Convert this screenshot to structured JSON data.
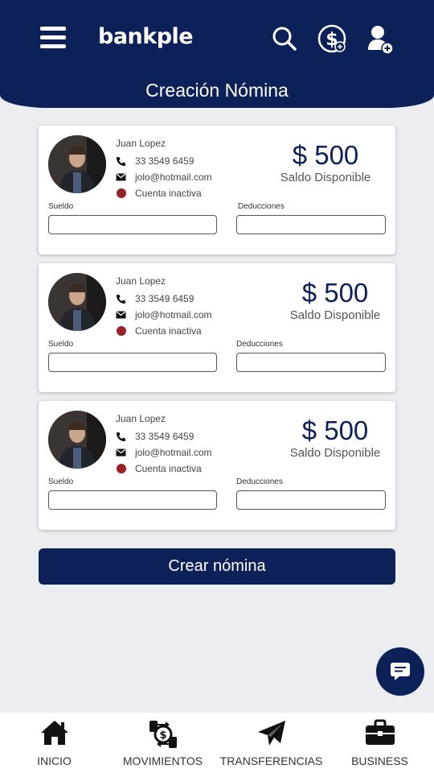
{
  "header": {
    "logo": "bankple",
    "title": "Creación Nómina",
    "icons": [
      "menu-icon",
      "search-icon",
      "dollar-add-icon",
      "user-add-icon"
    ]
  },
  "cards": [
    {
      "name": "Juan Lopez",
      "phone": "33 3549 6459",
      "email": "jolo@hotmail.com",
      "status": "Cuenta inactiva",
      "amount": "$ 500",
      "saldo_label": "Saldo Disponible",
      "sueldo_label": "Sueldo",
      "deducciones_label": "Deducciones"
    },
    {
      "name": "Juan Lopez",
      "phone": "33 3549 6459",
      "email": "jolo@hotmail.com",
      "status": "Cuenta inactiva",
      "amount": "$ 500",
      "saldo_label": "Saldo Disponible",
      "sueldo_label": "Sueldo",
      "deducciones_label": "Deducciones"
    },
    {
      "name": "Juan Lopez",
      "phone": "33 3549 6459",
      "email": "jolo@hotmail.com",
      "status": "Cuenta inactiva",
      "amount": "$ 500",
      "saldo_label": "Saldo Disponible",
      "sueldo_label": "Sueldo",
      "deducciones_label": "Deducciones"
    }
  ],
  "action": {
    "crear_label": "Crear nómina"
  },
  "nav": [
    {
      "label": "INICIO",
      "icon": "home-icon"
    },
    {
      "label": "MOVIMIENTOS",
      "icon": "money-exchange-icon"
    },
    {
      "label": "TRANSFERENCIAS",
      "icon": "paper-plane-icon"
    },
    {
      "label": "BUSINESS",
      "icon": "briefcase-icon"
    }
  ],
  "colors": {
    "primary": "#0c2157",
    "background": "#ebedf0",
    "status_inactive": "#9a1f24"
  }
}
